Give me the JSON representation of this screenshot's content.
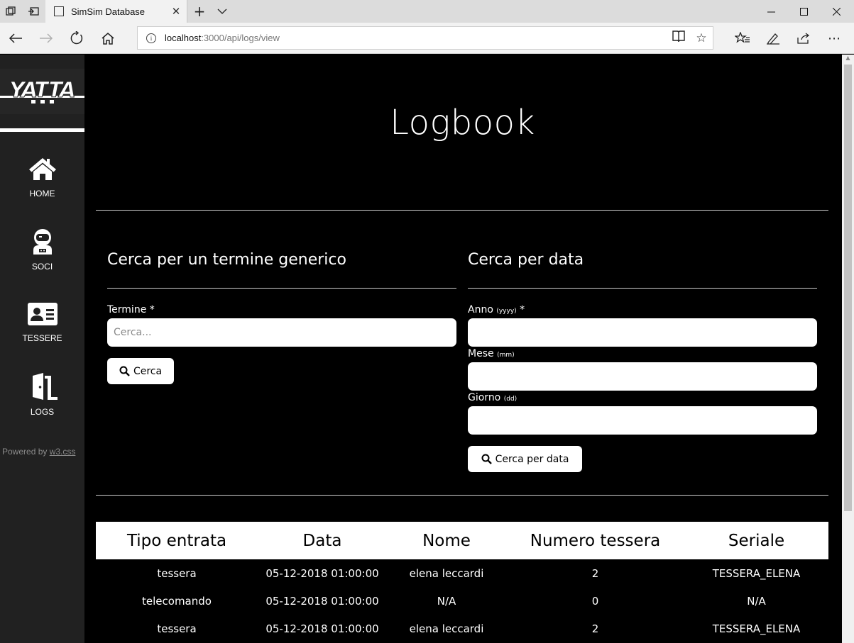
{
  "browser": {
    "tab_title": "SimSim Database",
    "url_host": "localhost",
    "url_rest": ":3000/api/logs/view"
  },
  "sidebar": {
    "logo_text": "YATTA",
    "items": [
      {
        "label": "HOME",
        "icon": "home-icon"
      },
      {
        "label": "SOCI",
        "icon": "astronaut-icon"
      },
      {
        "label": "TESSERE",
        "icon": "id-card-icon"
      },
      {
        "label": "LOGS",
        "icon": "door-open-icon"
      }
    ],
    "powered_prefix": "Powered by ",
    "powered_link": "w3.css"
  },
  "main": {
    "title": "Logbook",
    "generic_search": {
      "title": "Cerca per un termine generico",
      "term_label": "Termine *",
      "term_placeholder": "Cerca...",
      "button": "Cerca"
    },
    "date_search": {
      "title": "Cerca per data",
      "year_label": "Anno",
      "year_hint": "(yyyy)",
      "year_required": " *",
      "month_label": "Mese",
      "month_hint": "(mm)",
      "day_label": "Giorno",
      "day_hint": "(dd)",
      "button": "Cerca per data"
    },
    "table": {
      "headers": [
        "Tipo entrata",
        "Data",
        "Nome",
        "Numero tessera",
        "Seriale"
      ],
      "rows": [
        [
          "tessera",
          "05-12-2018 01:00:00",
          "elena leccardi",
          "2",
          "TESSERA_ELENA"
        ],
        [
          "telecomando",
          "05-12-2018 01:00:00",
          "N/A",
          "0",
          "N/A"
        ],
        [
          "tessera",
          "05-12-2018 01:00:00",
          "elena leccardi",
          "2",
          "TESSERA_ELENA"
        ]
      ]
    }
  }
}
